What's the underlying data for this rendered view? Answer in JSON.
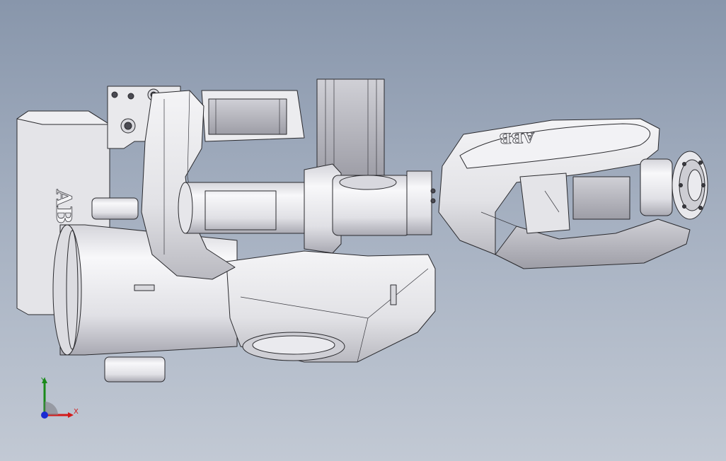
{
  "viewport": {
    "background_top": "#8896ab",
    "background_bottom": "#c2c9d4"
  },
  "model": {
    "logo_base": "AB",
    "logo_arm": "ABB",
    "body_color": "#e9e9ec",
    "shade_color": "#c9c9cf",
    "edge_color": "#2a2a2e"
  },
  "triad": {
    "x_label": "X",
    "y_label": "Y",
    "x_color": "#d21a1a",
    "y_color": "#1a8a1a",
    "origin_color": "#1a2ad2"
  }
}
